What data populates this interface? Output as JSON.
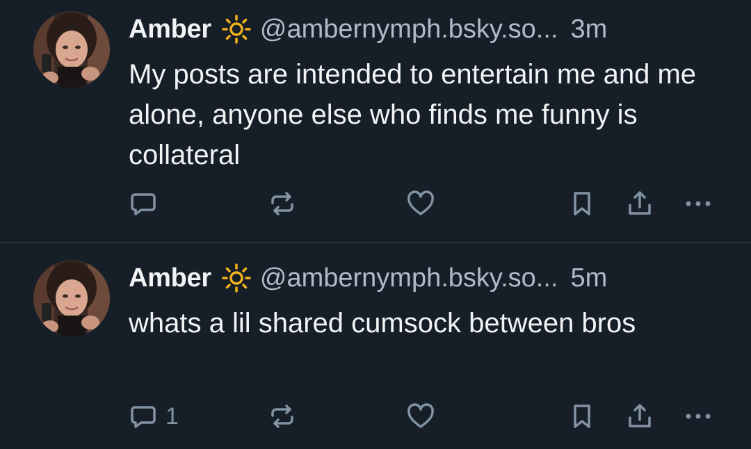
{
  "posts": [
    {
      "author": {
        "display_name": "Amber",
        "handle": "@ambernymph.bsky.so...",
        "badge_icon": "sun-icon",
        "avatar_icon": "avatar-photo"
      },
      "time": "3m",
      "text": "My posts are intended to entertain me and me alone, anyone else who finds me funny is collateral",
      "actions": {
        "reply_count": "",
        "reply_icon": "speech-bubble-icon",
        "repost_icon": "repost-arrows-icon",
        "like_icon": "heart-icon",
        "bookmark_icon": "bookmark-icon",
        "share_icon": "share-upload-icon",
        "more_icon": "ellipsis-icon"
      }
    },
    {
      "author": {
        "display_name": "Amber",
        "handle": "@ambernymph.bsky.so...",
        "badge_icon": "sun-icon",
        "avatar_icon": "avatar-photo"
      },
      "time": "5m",
      "text": "whats a lil shared cumsock between bros",
      "actions": {
        "reply_count": "1",
        "reply_icon": "speech-bubble-icon",
        "repost_icon": "repost-arrows-icon",
        "like_icon": "heart-icon",
        "bookmark_icon": "bookmark-icon",
        "share_icon": "share-upload-icon",
        "more_icon": "ellipsis-icon"
      }
    }
  ],
  "colors": {
    "background": "#161e27",
    "divider": "#243240",
    "text_primary": "#f1f3f5",
    "text_secondary": "#aebbc9",
    "icon": "#8293a4",
    "badge": "#f2b21c"
  }
}
